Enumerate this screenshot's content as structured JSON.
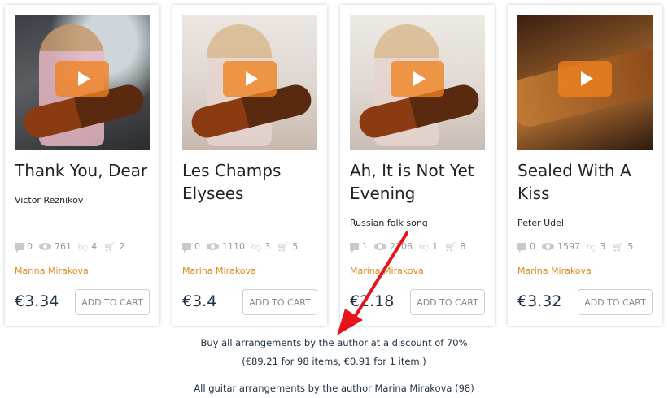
{
  "cards": [
    {
      "title": "Thank You, Dear",
      "composer": "Victor Reznikov",
      "comments": "0",
      "views": "761",
      "dislikes": "4",
      "carts": "2",
      "author": "Marina Mirakova",
      "price": "€3.34",
      "button": "ADD TO CART"
    },
    {
      "title": "Les Champs Elysees",
      "composer": "",
      "comments": "0",
      "views": "1110",
      "dislikes": "3",
      "carts": "5",
      "author": "Marina Mirakova",
      "price": "€3.4",
      "button": "ADD TO CART"
    },
    {
      "title": "Ah, It is Not Yet Evening",
      "composer": "Russian folk song",
      "comments": "1",
      "views": "2106",
      "dislikes": "1",
      "carts": "8",
      "author": "Marina Mirakova",
      "price": "€2.18",
      "button": "ADD TO CART"
    },
    {
      "title": "Sealed With A Kiss",
      "composer": "Peter Udell",
      "comments": "0",
      "views": "1597",
      "dislikes": "3",
      "carts": "5",
      "author": "Marina Mirakova",
      "price": "€3.32",
      "button": "ADD TO CART"
    }
  ],
  "bundle": {
    "offer": "Buy all arrangements by the author at a discount of 70%",
    "details": "(€89.21 for 98 items, €0.91 for 1 item.)",
    "all_link": "All guitar arrangements by the author Marina Mirakova (98)"
  },
  "colors": {
    "accent": "#e08a20",
    "arrow": "#e8141b"
  },
  "icons": [
    "comment-icon",
    "eye-icon",
    "dislike-icon",
    "cart-icon",
    "play-icon"
  ]
}
